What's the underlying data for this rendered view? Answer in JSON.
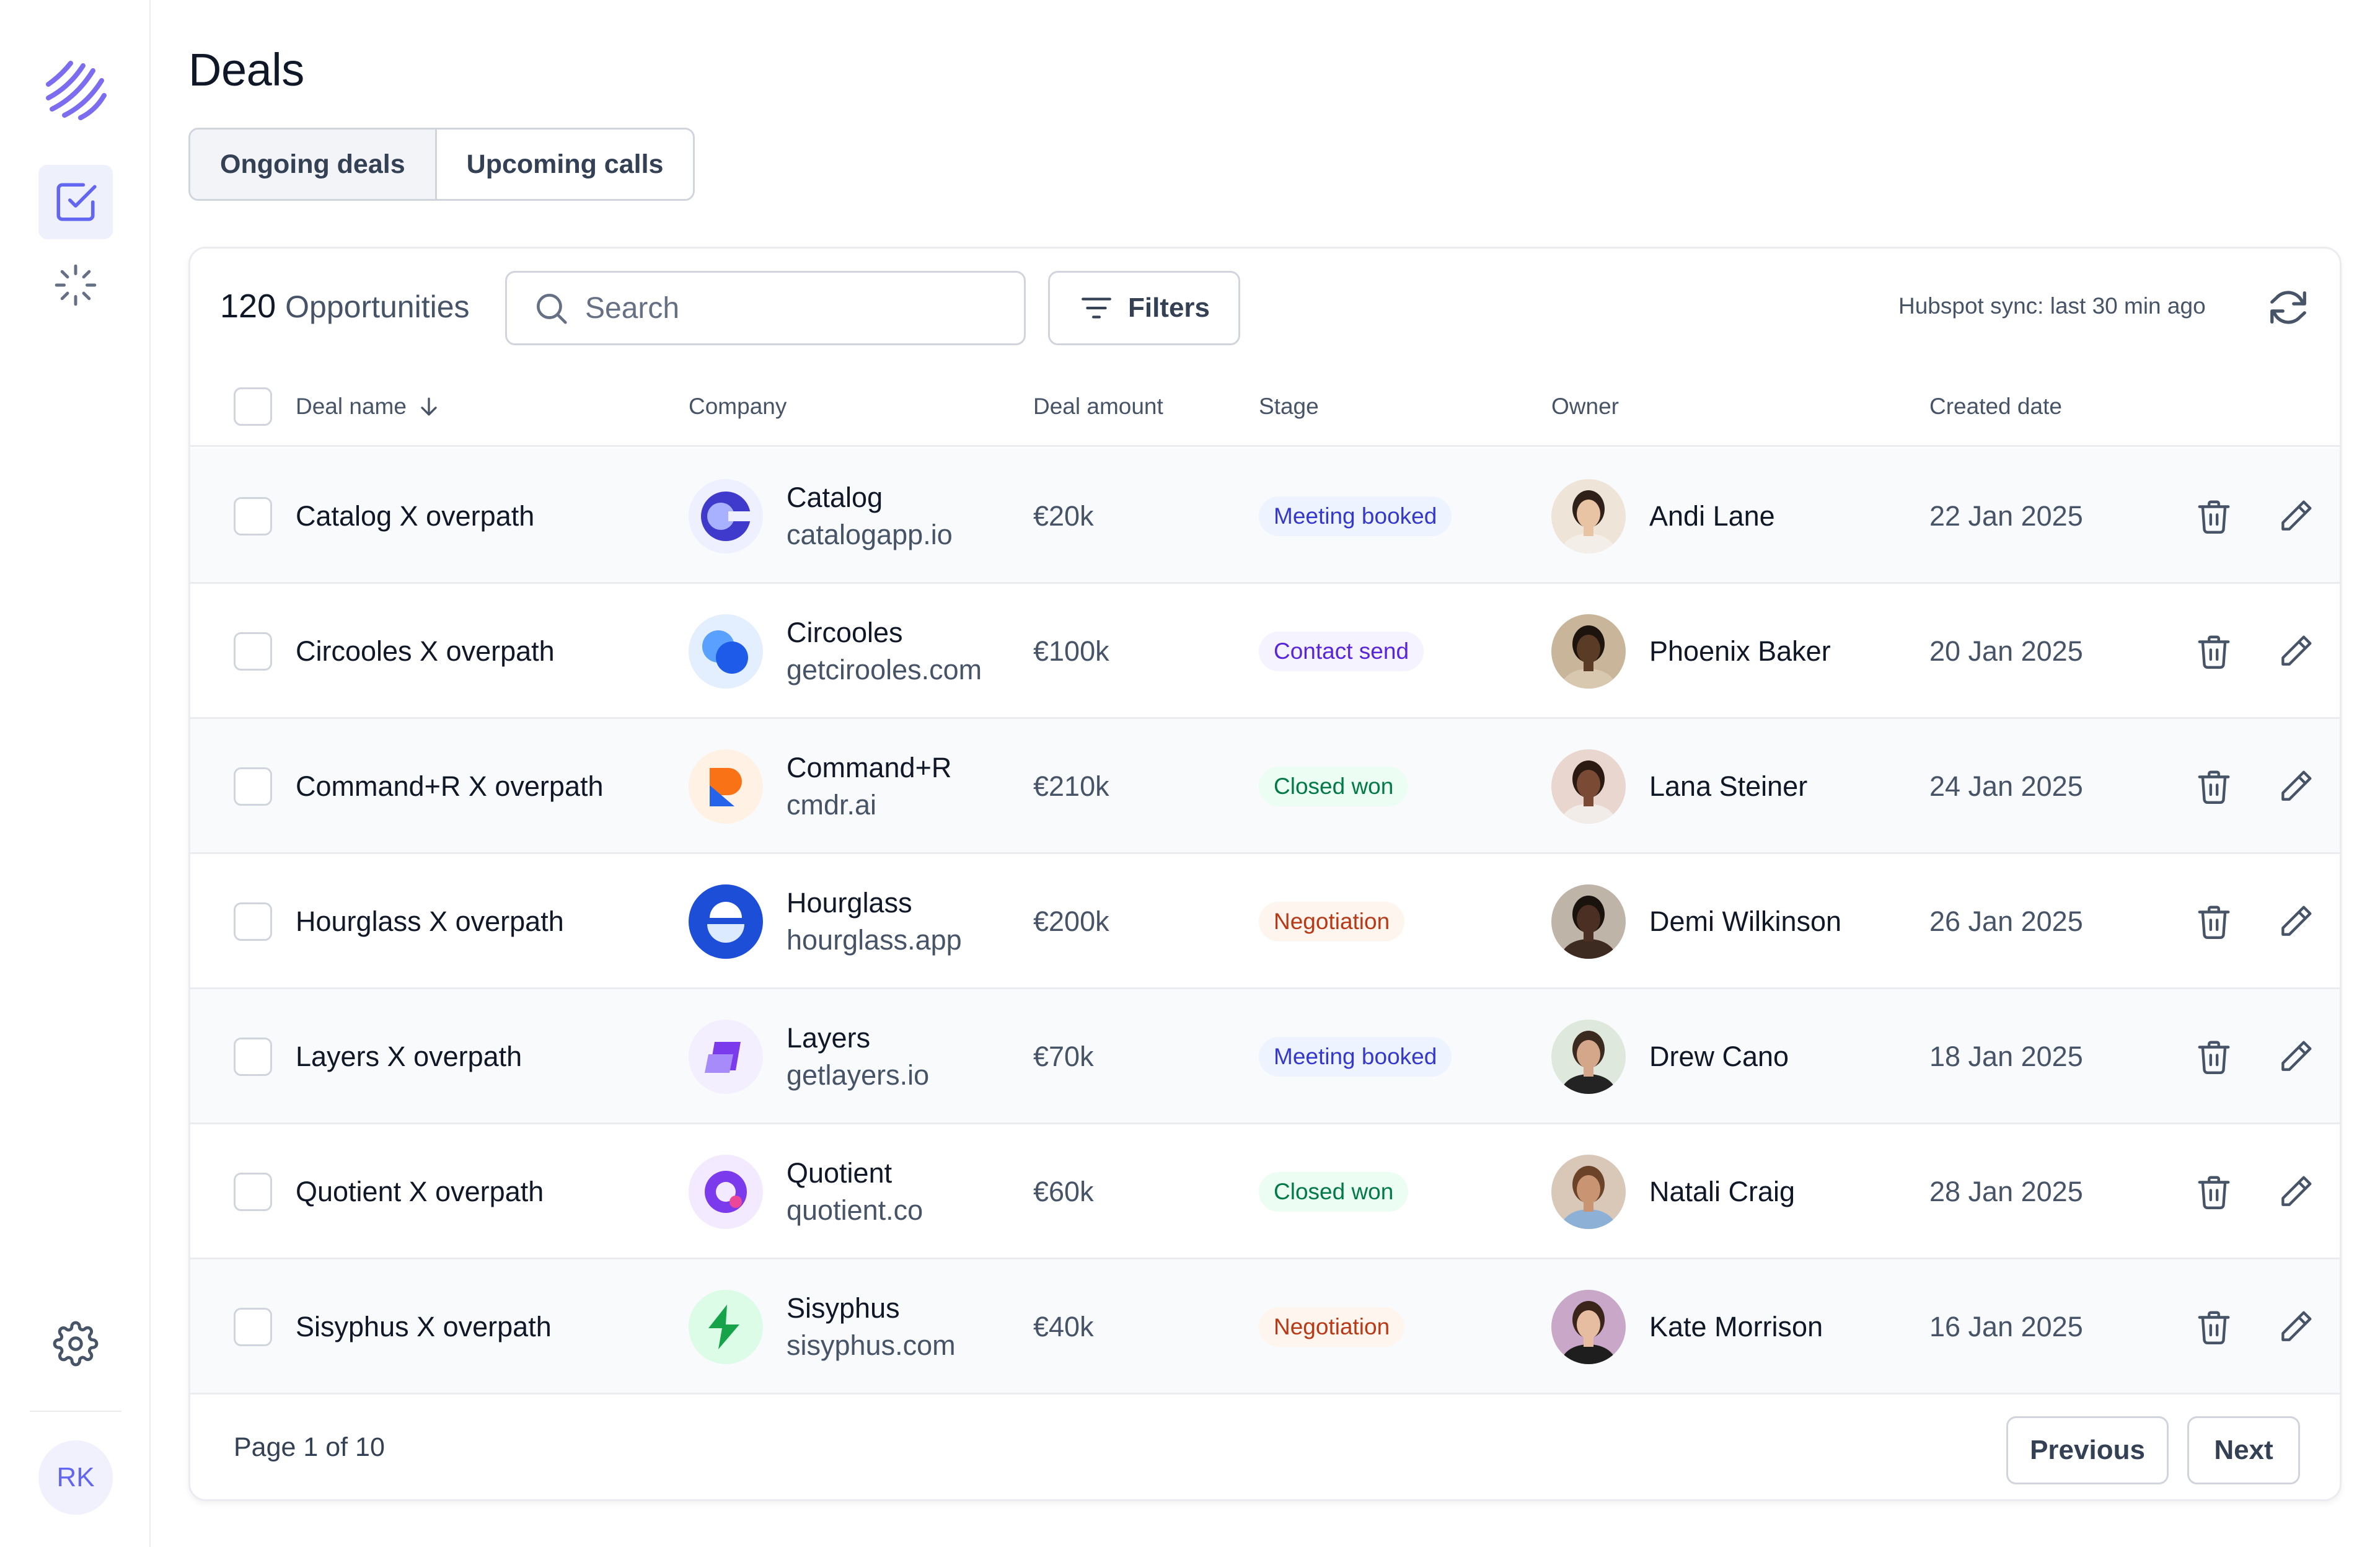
{
  "sidebar": {
    "logo_icon": "overpath-logo",
    "nav": [
      {
        "icon": "checkbox-icon",
        "active": true
      },
      {
        "icon": "loader-icon",
        "active": false
      }
    ],
    "settings_icon": "gear-icon",
    "user_initials": "RK"
  },
  "page": {
    "title": "Deals",
    "tabs": [
      {
        "label": "Ongoing deals",
        "active": true
      },
      {
        "label": "Upcoming calls",
        "active": false
      }
    ]
  },
  "toolbar": {
    "count": "120",
    "count_label": "Opportunities",
    "search_placeholder": "Search",
    "filters_label": "Filters",
    "sync_status": "Hubspot sync: last 30 min ago"
  },
  "table": {
    "columns": {
      "deal_name": "Deal name",
      "company": "Company",
      "amount": "Deal amount",
      "stage": "Stage",
      "owner": "Owner",
      "created": "Created date"
    },
    "stage_colors": {
      "Meeting booked": {
        "bg": "#eef4ff",
        "fg": "#3538cd"
      },
      "Contact send": {
        "bg": "#f4f3ff",
        "fg": "#5925dc"
      },
      "Closed won": {
        "bg": "#ecfdf3",
        "fg": "#027a48"
      },
      "Negotiation": {
        "bg": "#fef6ee",
        "fg": "#b93815"
      }
    },
    "rows": [
      {
        "deal": "Catalog X overpath",
        "company": "Catalog",
        "domain": "catalogapp.io",
        "amount": "€20k",
        "stage": "Meeting booked",
        "owner": "Andi Lane",
        "created": "22 Jan 2025"
      },
      {
        "deal": "Circooles X overpath",
        "company": "Circooles",
        "domain": "getcirooles.com",
        "amount": "€100k",
        "stage": "Contact send",
        "owner": "Phoenix Baker",
        "created": "20 Jan 2025"
      },
      {
        "deal": "Command+R X overpath",
        "company": "Command+R",
        "domain": "cmdr.ai",
        "amount": "€210k",
        "stage": "Closed won",
        "owner": "Lana Steiner",
        "created": "24 Jan 2025"
      },
      {
        "deal": "Hourglass X overpath",
        "company": "Hourglass",
        "domain": "hourglass.app",
        "amount": "€200k",
        "stage": "Negotiation",
        "owner": "Demi Wilkinson",
        "created": "26 Jan 2025"
      },
      {
        "deal": "Layers X overpath",
        "company": "Layers",
        "domain": "getlayers.io",
        "amount": "€70k",
        "stage": "Meeting booked",
        "owner": "Drew Cano",
        "created": "18 Jan 2025"
      },
      {
        "deal": "Quotient X overpath",
        "company": "Quotient",
        "domain": "quotient.co",
        "amount": "€60k",
        "stage": "Closed won",
        "owner": "Natali Craig",
        "created": "28 Jan 2025"
      },
      {
        "deal": "Sisyphus X overpath",
        "company": "Sisyphus",
        "domain": "sisyphus.com",
        "amount": "€40k",
        "stage": "Negotiation",
        "owner": "Kate Morrison",
        "created": "16 Jan 2025"
      }
    ]
  },
  "pagination": {
    "info": "Page 1 of 10",
    "previous_label": "Previous",
    "next_label": "Next"
  }
}
